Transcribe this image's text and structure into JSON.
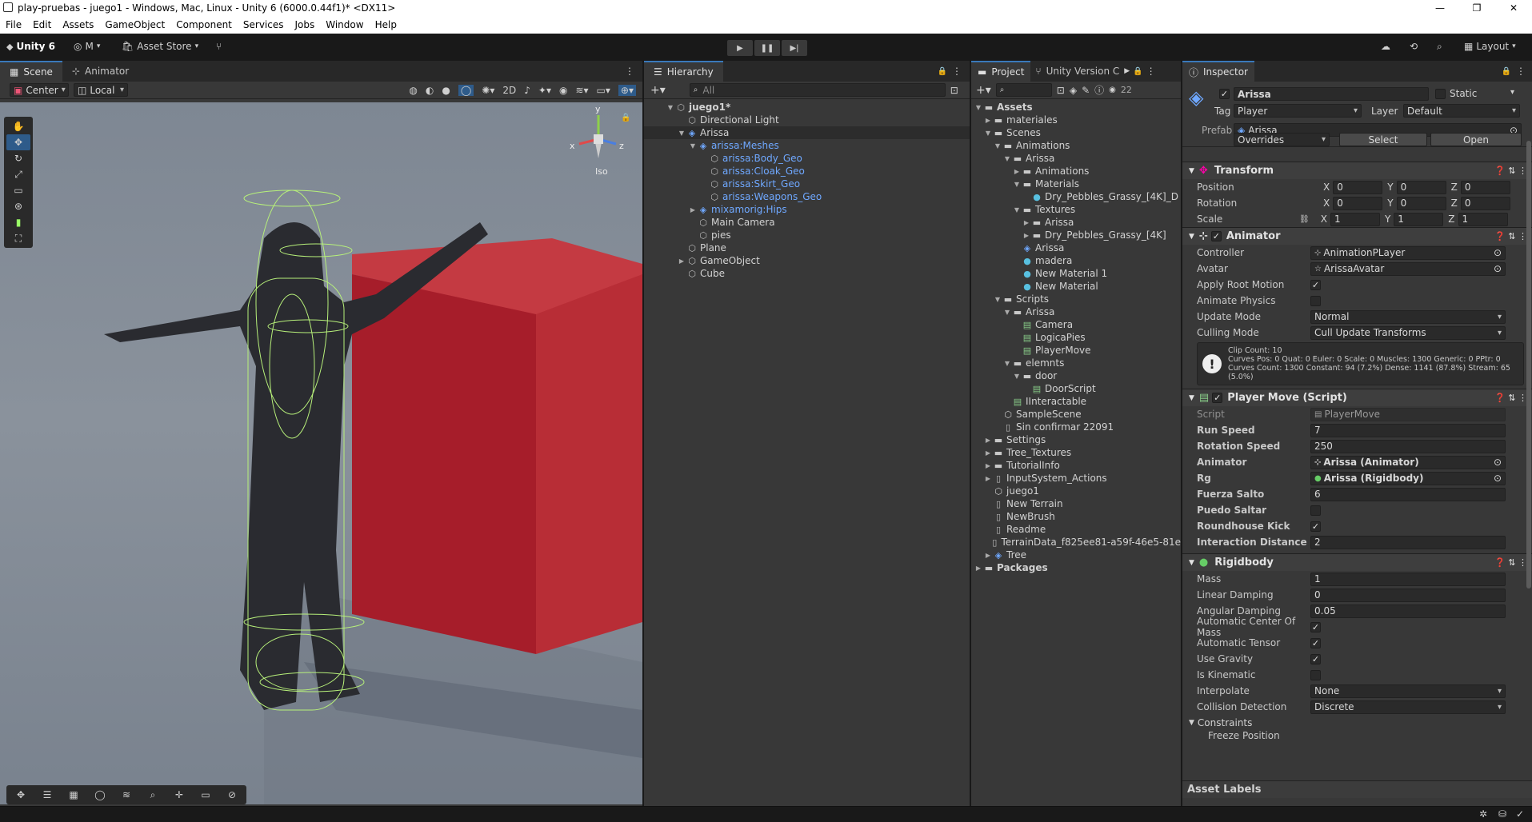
{
  "window": {
    "title": "play-pruebas - juego1 - Windows, Mac, Linux - Unity 6 (6000.0.44f1)* <DX11>",
    "menu": [
      "File",
      "Edit",
      "Assets",
      "GameObject",
      "Component",
      "Services",
      "Jobs",
      "Window",
      "Help"
    ]
  },
  "toolbar": {
    "unity_label": "Unity 6",
    "account_label": "M",
    "asset_store_label": "Asset Store",
    "layout_label": "Layout"
  },
  "scene": {
    "tabs": [
      "Scene",
      "Animator"
    ],
    "pivot_label": "Center",
    "space_label": "Local",
    "gizmo_axes": {
      "x": "x",
      "y": "y",
      "z": "z"
    },
    "persp_label": "Iso"
  },
  "hierarchy": {
    "tab_label": "Hierarchy",
    "search_placeholder": "All",
    "rows": [
      {
        "label": "juego1*",
        "depth": 0,
        "icon": "unity-scene-icon",
        "arrow": "▼",
        "bold": true
      },
      {
        "label": "Directional Light",
        "depth": 1,
        "icon": "cube-icon",
        "arrow": ""
      },
      {
        "label": "Arissa",
        "depth": 1,
        "icon": "prefab-icon",
        "arrow": "▼",
        "blue": false,
        "selected": true
      },
      {
        "label": "arissa:Meshes",
        "depth": 2,
        "icon": "prefab-icon",
        "arrow": "▼",
        "blue": true
      },
      {
        "label": "arissa:Body_Geo",
        "depth": 3,
        "icon": "cube-icon",
        "arrow": "",
        "blue": true
      },
      {
        "label": "arissa:Cloak_Geo",
        "depth": 3,
        "icon": "cube-icon",
        "arrow": "",
        "blue": true
      },
      {
        "label": "arissa:Skirt_Geo",
        "depth": 3,
        "icon": "cube-icon",
        "arrow": "",
        "blue": true
      },
      {
        "label": "arissa:Weapons_Geo",
        "depth": 3,
        "icon": "cube-icon",
        "arrow": "",
        "blue": true
      },
      {
        "label": "mixamorig:Hips",
        "depth": 2,
        "icon": "prefab-icon",
        "arrow": "▶",
        "blue": true
      },
      {
        "label": "Main Camera",
        "depth": 2,
        "icon": "cube-icon",
        "arrow": ""
      },
      {
        "label": "pies",
        "depth": 2,
        "icon": "cube-icon",
        "arrow": ""
      },
      {
        "label": "Plane",
        "depth": 1,
        "icon": "cube-icon",
        "arrow": ""
      },
      {
        "label": "GameObject",
        "depth": 1,
        "icon": "cube-icon",
        "arrow": "▶"
      },
      {
        "label": "Cube",
        "depth": 1,
        "icon": "cube-icon",
        "arrow": ""
      }
    ]
  },
  "project": {
    "tabs": [
      "Project",
      "Unity Version C"
    ],
    "count_label": "22",
    "rows": [
      {
        "label": "Assets",
        "depth": 0,
        "arrow": "▼",
        "bold": true,
        "icon": "folder"
      },
      {
        "label": "materiales",
        "depth": 1,
        "arrow": "▶",
        "icon": "folder"
      },
      {
        "label": "Scenes",
        "depth": 1,
        "arrow": "▼",
        "icon": "folder"
      },
      {
        "label": "Animations",
        "depth": 2,
        "arrow": "▼",
        "icon": "folder"
      },
      {
        "label": "Arissa",
        "depth": 3,
        "arrow": "▼",
        "icon": "folder"
      },
      {
        "label": "Animations",
        "depth": 4,
        "arrow": "▶",
        "icon": "folder"
      },
      {
        "label": "Materials",
        "depth": 4,
        "arrow": "▼",
        "icon": "folder"
      },
      {
        "label": "Dry_Pebbles_Grassy_[4K]_D",
        "depth": 5,
        "arrow": "",
        "icon": "material"
      },
      {
        "label": "Textures",
        "depth": 4,
        "arrow": "▼",
        "icon": "folder"
      },
      {
        "label": "Arissa",
        "depth": 5,
        "arrow": "▶",
        "icon": "folder"
      },
      {
        "label": "Dry_Pebbles_Grassy_[4K]",
        "depth": 5,
        "arrow": "▶",
        "icon": "folder"
      },
      {
        "label": "Arissa",
        "depth": 4,
        "arrow": "",
        "icon": "prefab"
      },
      {
        "label": "madera",
        "depth": 4,
        "arrow": "",
        "icon": "material"
      },
      {
        "label": "New Material 1",
        "depth": 4,
        "arrow": "",
        "icon": "material"
      },
      {
        "label": "New Material",
        "depth": 4,
        "arrow": "",
        "icon": "material"
      },
      {
        "label": "Scripts",
        "depth": 2,
        "arrow": "▼",
        "icon": "folder"
      },
      {
        "label": "Arissa",
        "depth": 3,
        "arrow": "▼",
        "icon": "folder"
      },
      {
        "label": "Camera",
        "depth": 4,
        "arrow": "",
        "icon": "script"
      },
      {
        "label": "LogicaPies",
        "depth": 4,
        "arrow": "",
        "icon": "script"
      },
      {
        "label": "PlayerMove",
        "depth": 4,
        "arrow": "",
        "icon": "script"
      },
      {
        "label": "elemnts",
        "depth": 3,
        "arrow": "▼",
        "icon": "folder"
      },
      {
        "label": "door",
        "depth": 4,
        "arrow": "▼",
        "icon": "folder"
      },
      {
        "label": "DoorScript",
        "depth": 5,
        "arrow": "",
        "icon": "script"
      },
      {
        "label": "IInteractable",
        "depth": 3,
        "arrow": "",
        "icon": "script"
      },
      {
        "label": "SampleScene",
        "depth": 2,
        "arrow": "",
        "icon": "scene"
      },
      {
        "label": "Sin confirmar 22091",
        "depth": 2,
        "arrow": "",
        "icon": "file"
      },
      {
        "label": "Settings",
        "depth": 1,
        "arrow": "▶",
        "icon": "folder"
      },
      {
        "label": "Tree_Textures",
        "depth": 1,
        "arrow": "▶",
        "icon": "folder"
      },
      {
        "label": "TutorialInfo",
        "depth": 1,
        "arrow": "▶",
        "icon": "folder"
      },
      {
        "label": "InputSystem_Actions",
        "depth": 1,
        "arrow": "▶",
        "icon": "file"
      },
      {
        "label": "juego1",
        "depth": 1,
        "arrow": "",
        "icon": "scene"
      },
      {
        "label": "New Terrain",
        "depth": 1,
        "arrow": "",
        "icon": "file"
      },
      {
        "label": "NewBrush",
        "depth": 1,
        "arrow": "",
        "icon": "file"
      },
      {
        "label": "Readme",
        "depth": 1,
        "arrow": "",
        "icon": "file"
      },
      {
        "label": "TerrainData_f825ee81-a59f-46e5-81e",
        "depth": 1,
        "arrow": "",
        "icon": "file"
      },
      {
        "label": "Tree",
        "depth": 1,
        "arrow": "▶",
        "icon": "prefab"
      },
      {
        "label": "Packages",
        "depth": 0,
        "arrow": "▶",
        "bold": true,
        "icon": "folder"
      }
    ]
  },
  "inspector": {
    "tab_label": "Inspector",
    "object_name": "Arissa",
    "static_label": "Static",
    "tag_label": "Tag",
    "tag_value": "Player",
    "layer_label": "Layer",
    "layer_value": "Default",
    "prefab_label": "Prefab",
    "prefab_value": "Arissa",
    "overrides_label": "Overrides",
    "select_label": "Select",
    "open_label": "Open",
    "transform": {
      "title": "Transform",
      "position_label": "Position",
      "position": [
        "0",
        "0",
        "0"
      ],
      "rotation_label": "Rotation",
      "rotation": [
        "0",
        "0",
        "0"
      ],
      "scale_label": "Scale",
      "scale": [
        "1",
        "1",
        "1"
      ],
      "axes": [
        "X",
        "Y",
        "Z"
      ]
    },
    "animator": {
      "title": "Animator",
      "controller_label": "Controller",
      "controller_value": "AnimationPLayer",
      "avatar_label": "Avatar",
      "avatar_value": "ArissaAvatar",
      "apply_root_label": "Apply Root Motion",
      "apply_root": true,
      "animate_physics_label": "Animate Physics",
      "animate_physics": false,
      "update_mode_label": "Update Mode",
      "update_mode": "Normal",
      "culling_mode_label": "Culling Mode",
      "culling_mode": "Cull Update Transforms",
      "info_line1": "Clip Count: 10",
      "info_line2": "Curves Pos: 0 Quat: 0 Euler: 0 Scale: 0 Muscles: 1300 Generic: 0 PPtr: 0",
      "info_line3": "Curves Count: 1300 Constant: 94 (7.2%) Dense: 1141 (87.8%) Stream: 65",
      "info_line4": "(5.0%)"
    },
    "player_move": {
      "title": "Player Move (Script)",
      "script_label": "Script",
      "script_value": "PlayerMove",
      "run_speed_label": "Run Speed",
      "run_speed": "7",
      "rotation_speed_label": "Rotation Speed",
      "rotation_speed": "250",
      "animator_label": "Animator",
      "animator_value": "Arissa (Animator)",
      "rg_label": "Rg",
      "rg_value": "Arissa (Rigidbody)",
      "fuerza_label": "Fuerza Salto",
      "fuerza": "6",
      "puedo_label": "Puedo Saltar",
      "puedo": false,
      "roundhouse_label": "Roundhouse Kick",
      "roundhouse": true,
      "interaction_label": "Interaction Distance",
      "interaction": "2"
    },
    "rigidbody": {
      "title": "Rigidbody",
      "mass_label": "Mass",
      "mass": "1",
      "linear_label": "Linear Damping",
      "linear": "0",
      "angular_label": "Angular Damping",
      "angular": "0.05",
      "auto_com_label": "Automatic Center Of Mass",
      "auto_com": true,
      "auto_tensor_label": "Automatic Tensor",
      "auto_tensor": true,
      "gravity_label": "Use Gravity",
      "gravity": true,
      "kinematic_label": "Is Kinematic",
      "kinematic": false,
      "interpolate_label": "Interpolate",
      "interpolate": "None",
      "collision_label": "Collision Detection",
      "collision": "Discrete",
      "constraints_label": "Constraints",
      "freeze_pos_label": "Freeze Position"
    },
    "asset_labels": "Asset Labels"
  },
  "colors": {
    "accent": "#3a79bb",
    "selection": "#2c5d87",
    "prefab_blue": "#6fa8ff",
    "panel": "#383838",
    "cube_red": "#b02530"
  }
}
